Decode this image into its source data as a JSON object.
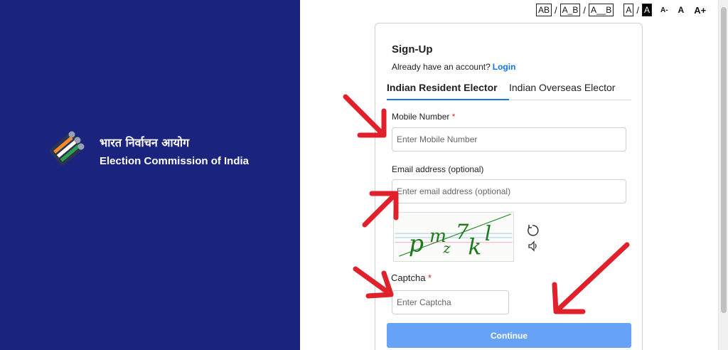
{
  "brand": {
    "hindi_name": "भारत निर्वाचन आयोग",
    "english_name": "Election Commission of India"
  },
  "accessibility": {
    "text_spacing": [
      "AB",
      "A_B",
      "A__B"
    ],
    "contrast": [
      "A",
      "A"
    ],
    "font_sizes": [
      "A-",
      "A",
      "A+"
    ]
  },
  "form": {
    "title": "Sign-Up",
    "have_account_text": "Already have an account?",
    "login_link": "Login",
    "tabs": [
      {
        "label": "Indian Resident Elector",
        "active": true
      },
      {
        "label": "Indian Overseas Elector",
        "active": false
      }
    ],
    "mobile": {
      "label": "Mobile Number",
      "required_mark": "*",
      "placeholder": "Enter Mobile Number"
    },
    "email": {
      "label": "Email address (optional)",
      "placeholder": "Enter email address (optional)"
    },
    "captcha": {
      "image_text": "pmz7kl",
      "label": "Captcha",
      "required_mark": "*",
      "placeholder": "Enter Captcha"
    },
    "continue_label": "Continue"
  },
  "colors": {
    "panel": "#1a237e",
    "accent": "#1a73e8",
    "button": "#66a3f7",
    "annotation_arrow": "#e0202a"
  },
  "icons": [
    "refresh-icon",
    "speaker-icon",
    "eci-logo"
  ]
}
